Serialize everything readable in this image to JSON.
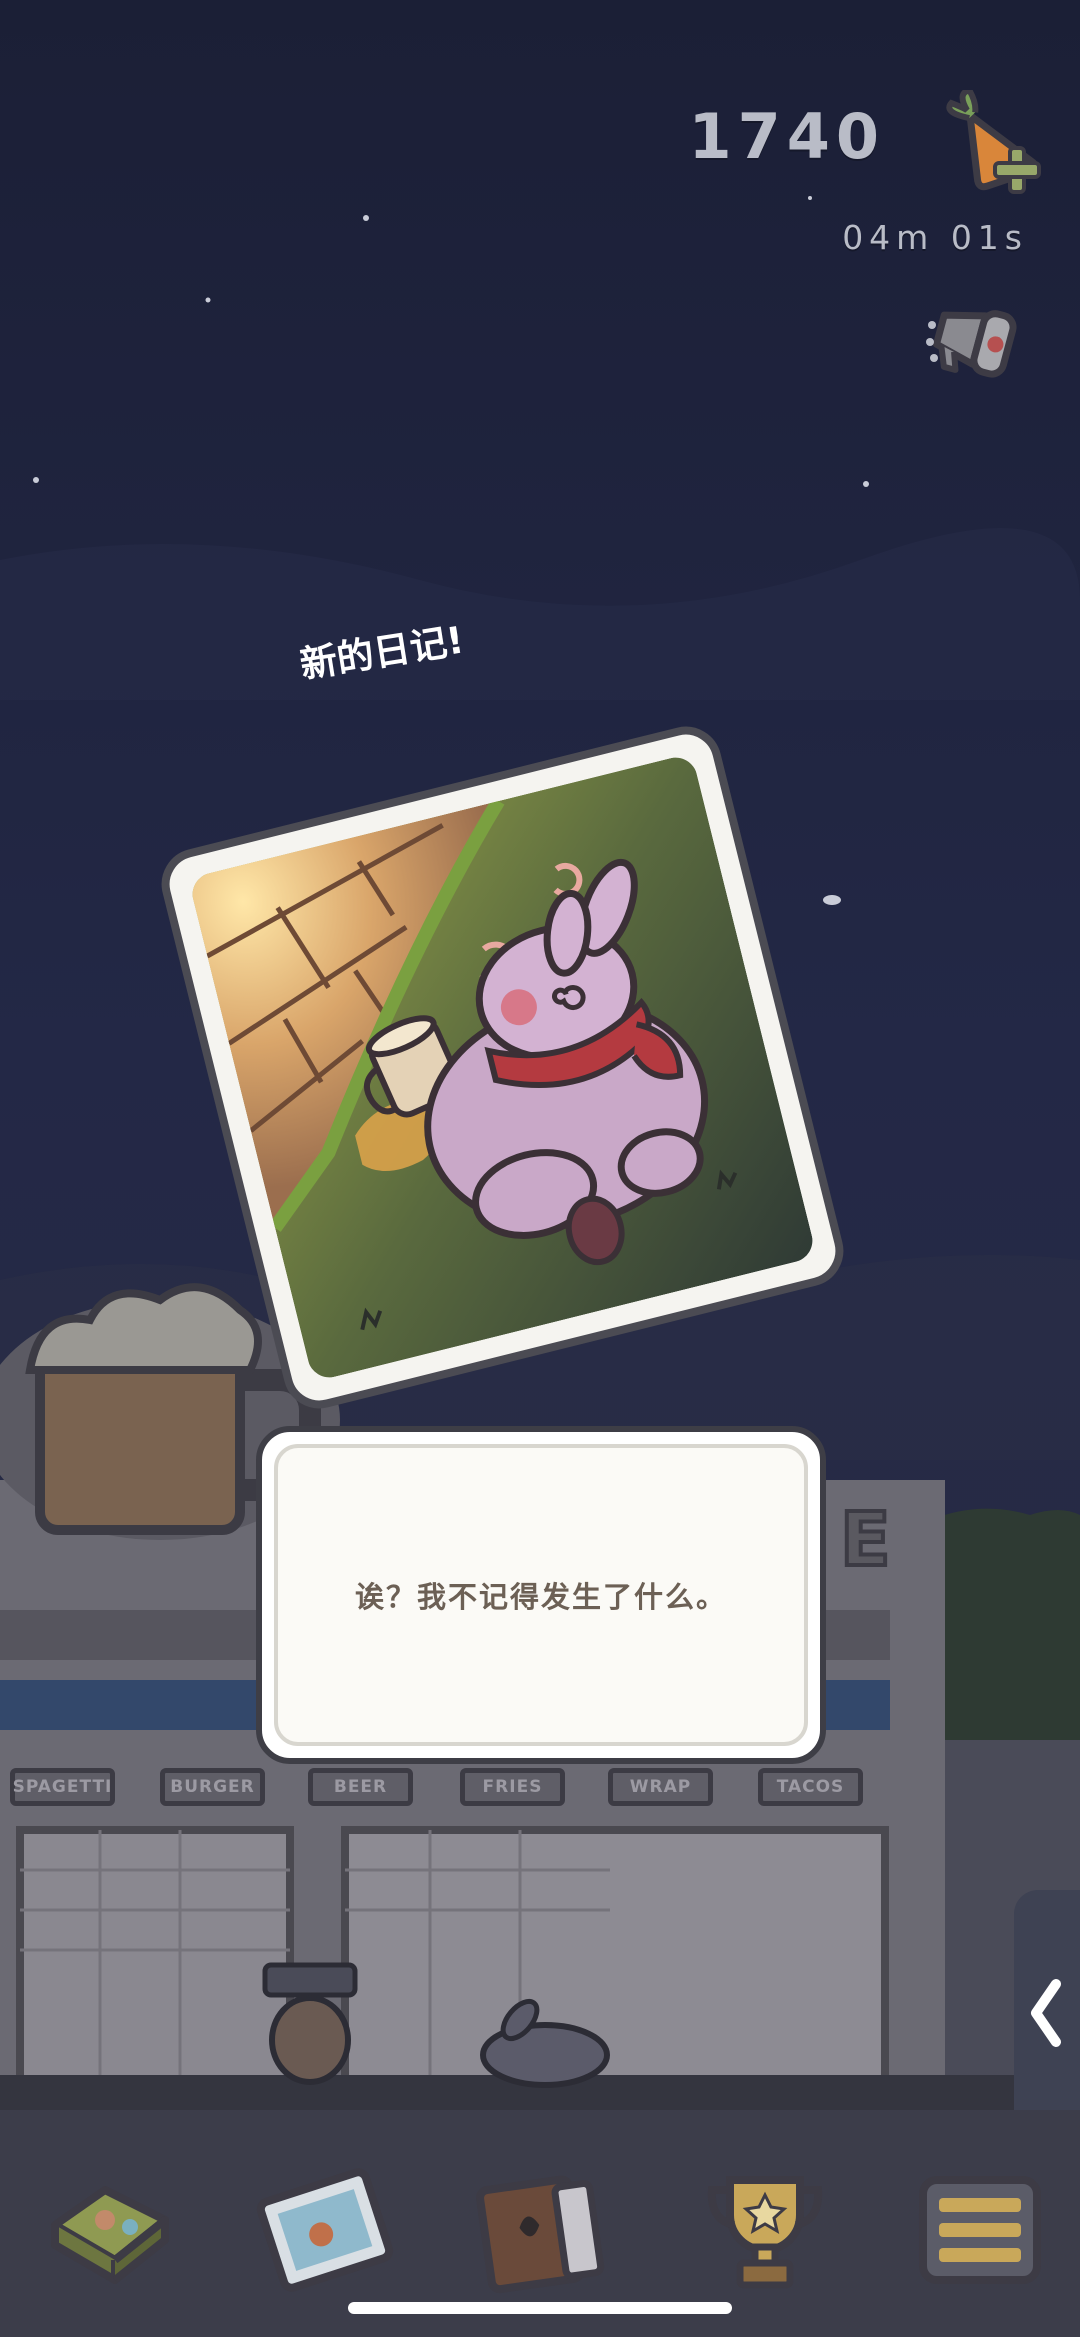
{
  "hud": {
    "carrot_count": "1740",
    "timer": "04m 01s"
  },
  "event": {
    "title": "新的日记!"
  },
  "dialog": {
    "text": "诶？我不记得发生了什么。"
  },
  "shop": {
    "menu_signs": [
      "SPAGETTI",
      "BURGER",
      "BEER",
      "FRIES",
      "WRAP",
      "TACOS"
    ]
  },
  "icons": {
    "carrot_plus": "carrot-plus-icon",
    "megaphone": "megaphone-icon",
    "side_arrow": "chevron-left-icon",
    "tabs": [
      "food-box-icon",
      "postcard-icon",
      "diary-book-icon",
      "trophy-icon",
      "menu-icon"
    ]
  },
  "colors": {
    "sky": "#1e2440",
    "dialog_text": "#6c6055",
    "card_border": "#4b4b53"
  }
}
